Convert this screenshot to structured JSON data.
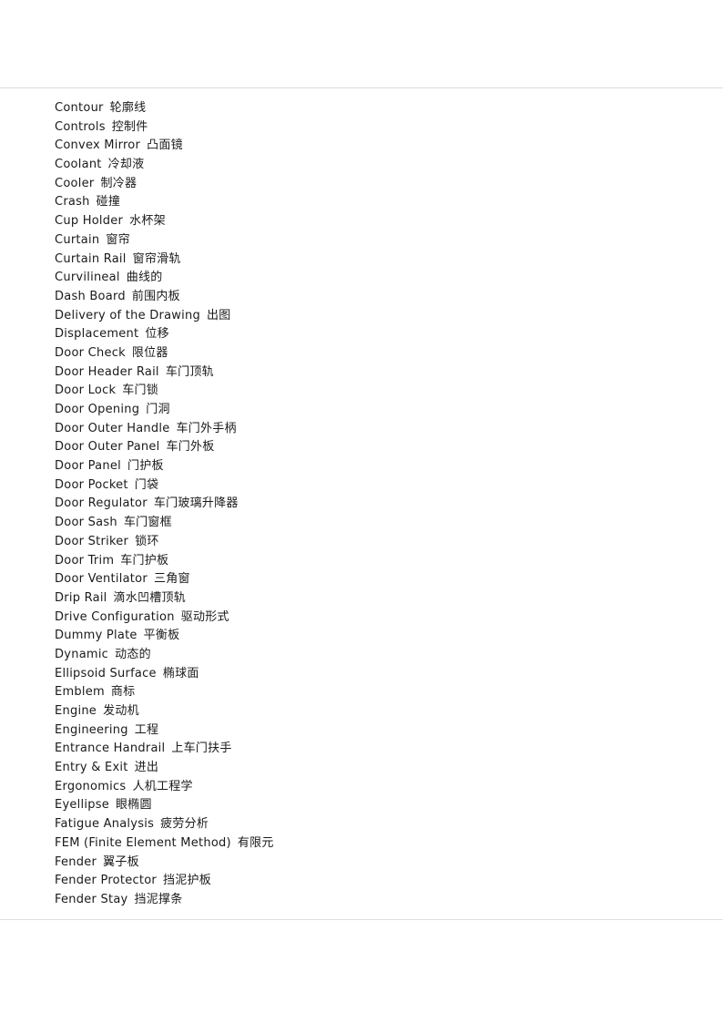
{
  "page": {
    "rule_color": "#dedede",
    "background_color": "#ffffff",
    "text_color": "#1a1a1a"
  },
  "glossary": {
    "entries": [
      {
        "term": "Contour",
        "translation": "轮廓线"
      },
      {
        "term": "Controls",
        "translation": "控制件"
      },
      {
        "term": "Convex Mirror",
        "translation": "凸面镜"
      },
      {
        "term": "Coolant",
        "translation": "冷却液"
      },
      {
        "term": "Cooler",
        "translation": "制冷器"
      },
      {
        "term": "Crash",
        "translation": "碰撞"
      },
      {
        "term": "Cup Holder",
        "translation": "水杯架"
      },
      {
        "term": "Curtain",
        "translation": "窗帘"
      },
      {
        "term": "Curtain Rail",
        "translation": "窗帘滑轨"
      },
      {
        "term": "Curvilineal",
        "translation": "曲线的"
      },
      {
        "term": "Dash Board",
        "translation": "前围内板"
      },
      {
        "term": "Delivery of the Drawing",
        "translation": "出图"
      },
      {
        "term": "Displacement",
        "translation": "位移"
      },
      {
        "term": "Door Check",
        "translation": "限位器"
      },
      {
        "term": "Door Header Rail",
        "translation": "车门顶轨"
      },
      {
        "term": "Door Lock",
        "translation": "车门锁"
      },
      {
        "term": "Door Opening",
        "translation": "门洞"
      },
      {
        "term": "Door Outer Handle",
        "translation": "车门外手柄"
      },
      {
        "term": "Door Outer Panel",
        "translation": "车门外板"
      },
      {
        "term": "Door Panel",
        "translation": "门护板"
      },
      {
        "term": "Door Pocket",
        "translation": "门袋"
      },
      {
        "term": "Door Regulator",
        "translation": "车门玻璃升降器"
      },
      {
        "term": "Door Sash",
        "translation": "车门窗框"
      },
      {
        "term": "Door Striker",
        "translation": "锁环"
      },
      {
        "term": "Door Trim",
        "translation": "车门护板"
      },
      {
        "term": "Door Ventilator",
        "translation": "三角窗"
      },
      {
        "term": "Drip Rail",
        "translation": "滴水凹槽顶轨"
      },
      {
        "term": "Drive Configuration",
        "translation": "驱动形式"
      },
      {
        "term": "Dummy Plate",
        "translation": "平衡板"
      },
      {
        "term": "Dynamic",
        "translation": "动态的"
      },
      {
        "term": "Ellipsoid Surface",
        "translation": "椭球面"
      },
      {
        "term": "Emblem",
        "translation": "商标"
      },
      {
        "term": "Engine",
        "translation": "发动机"
      },
      {
        "term": "Engineering",
        "translation": "工程"
      },
      {
        "term": "Entrance Handrail",
        "translation": "上车门扶手"
      },
      {
        "term": "Entry & Exit",
        "translation": "进出"
      },
      {
        "term": "Ergonomics",
        "translation": "人机工程学"
      },
      {
        "term": "Eyellipse",
        "translation": "眼椭圆"
      },
      {
        "term": "Fatigue Analysis",
        "translation": "疲劳分析"
      },
      {
        "term": "FEM (Finite Element Method)",
        "translation": "有限元"
      },
      {
        "term": "Fender",
        "translation": "翼子板"
      },
      {
        "term": "Fender Protector",
        "translation": "挡泥护板"
      },
      {
        "term": "Fender Stay",
        "translation": "挡泥撑条"
      }
    ]
  }
}
